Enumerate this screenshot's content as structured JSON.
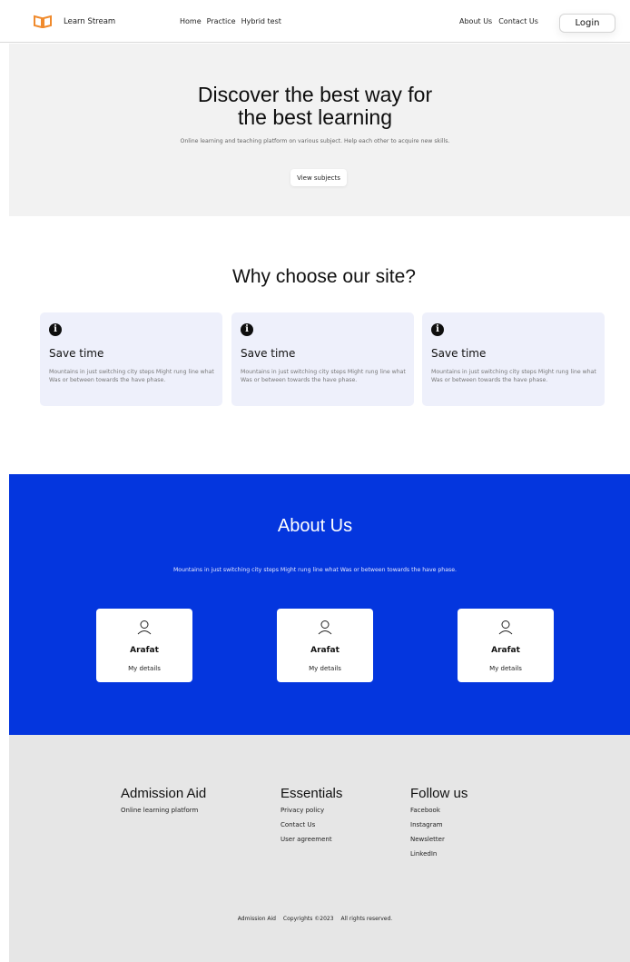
{
  "colors": {
    "accent": "#0436de",
    "logo": "#f08a2c",
    "card_bg": "#eef0fb",
    "footer_bg": "#e6e6e6",
    "hero_bg": "#f2f2f2"
  },
  "nav": {
    "brand": "Learn Stream",
    "logo_icon": "open-book-icon",
    "links": [
      "Home",
      "Practice",
      "Hybrid test"
    ],
    "right_links": [
      "About Us",
      "Contact Us"
    ],
    "login": "Login"
  },
  "hero": {
    "title_line1": "Discover the  best way for",
    "title_line2": "the best learning",
    "subtitle": "Online learning and teaching platform on various subject. Help each other to acquire new skills.",
    "button": "View subjects"
  },
  "why": {
    "title": "Why choose our site?",
    "cards": [
      {
        "icon": "info-icon",
        "title": "Save time",
        "text": "Mountains in just switching city steps Might rung line what Was or between towards the have phase."
      },
      {
        "icon": "info-icon",
        "title": "Save time",
        "text": "Mountains in just switching city steps Might rung line what Was or between towards the have phase."
      },
      {
        "icon": "info-icon",
        "title": "Save time",
        "text": "Mountains in just switching city steps Might rung line what Was or between towards the have phase."
      }
    ]
  },
  "about": {
    "title": "About Us",
    "subtitle": "Mountains in just switching city steps Might rung line what Was or between towards the have phase.",
    "people": [
      {
        "icon": "user-icon",
        "name": "Arafat",
        "details": "My details"
      },
      {
        "icon": "user-icon",
        "name": "Arafat",
        "details": "My details"
      },
      {
        "icon": "user-icon",
        "name": "Arafat",
        "details": "My details"
      }
    ]
  },
  "footer": {
    "col1": {
      "title": "Admission Aid",
      "items": [
        "Online learning platform"
      ]
    },
    "col2": {
      "title": "Essentials",
      "items": [
        "Privacy policy",
        "Contact Us",
        "User agreement"
      ]
    },
    "col3": {
      "title": "Follow us",
      "items": [
        "Facebook",
        "Instagram",
        "Newsletter",
        "LinkedIn"
      ]
    },
    "copyright": {
      "brand": "Admission Aid",
      "text": "Copyrights ©2023",
      "rights": "All rights reserved."
    }
  }
}
